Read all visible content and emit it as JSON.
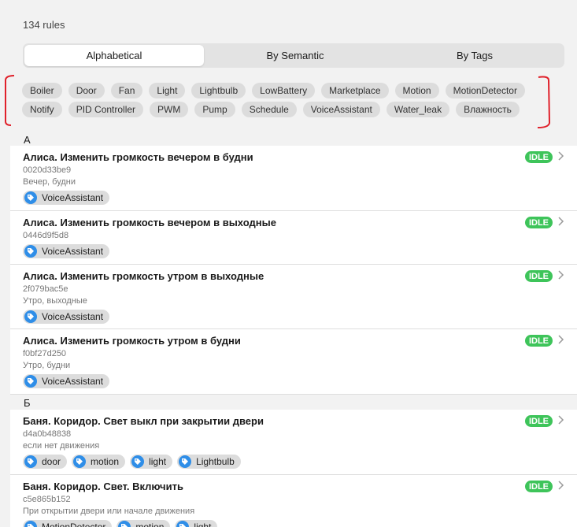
{
  "header": {
    "rule_count": "134 rules"
  },
  "tabs": [
    {
      "label": "Alphabetical",
      "active": true
    },
    {
      "label": "By Semantic",
      "active": false
    },
    {
      "label": "By Tags",
      "active": false
    }
  ],
  "tag_filters": [
    "Boiler",
    "Door",
    "Fan",
    "Light",
    "Lightbulb",
    "LowBattery",
    "Marketplace",
    "Motion",
    "MotionDetector",
    "Notify",
    "PID Controller",
    "PWM",
    "Pump",
    "Schedule",
    "VoiceAssistant",
    "Water_leak",
    "Влажность"
  ],
  "groups": [
    {
      "letter": "А",
      "rules": [
        {
          "title": "Алиса. Изменить громкость вечером в будни",
          "id": "0020d33be9",
          "description": "Вечер, будни",
          "status": "IDLE",
          "tags": [
            "VoiceAssistant"
          ]
        },
        {
          "title": "Алиса. Изменить громкость вечером в выходные",
          "id": "0446d9f5d8",
          "description": "",
          "status": "IDLE",
          "tags": [
            "VoiceAssistant"
          ]
        },
        {
          "title": "Алиса. Изменить громкость утром в выходные",
          "id": "2f079bac5e",
          "description": "Утро, выходные",
          "status": "IDLE",
          "tags": [
            "VoiceAssistant"
          ]
        },
        {
          "title": "Алиса. Изменить громкость утром в будни",
          "id": "f0bf27d250",
          "description": "Утро, будни",
          "status": "IDLE",
          "tags": [
            "VoiceAssistant"
          ]
        }
      ]
    },
    {
      "letter": "Б",
      "rules": [
        {
          "title": "Баня. Коридор. Свет выкл при закрытии двери",
          "id": "d4a0b48838",
          "description": "если нет движения",
          "status": "IDLE",
          "tags": [
            "door",
            "motion",
            "light",
            "Lightbulb"
          ]
        },
        {
          "title": "Баня. Коридор. Свет. Включить",
          "id": "c5e865b152",
          "description": "При открытии двери или начале движения",
          "status": "IDLE",
          "tags": [
            "MotionDetector",
            "motion",
            "light"
          ]
        }
      ]
    }
  ],
  "colors": {
    "status_idle": "#3ec45a",
    "tag_icon": "#2f8ee8",
    "annotation": "#e0202a"
  },
  "icons": {
    "tag": "tag-icon",
    "chevron": "chevron-right-icon"
  }
}
